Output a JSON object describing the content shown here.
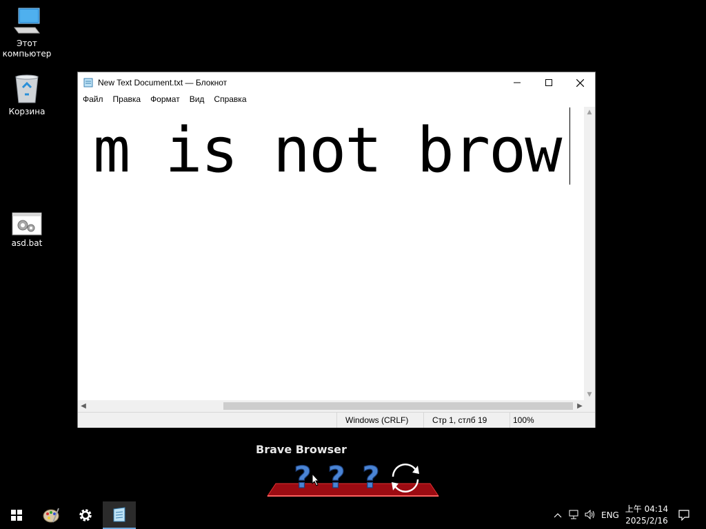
{
  "desktop": {
    "icons": [
      {
        "label_line1": "Этот",
        "label_line2": "компьютер",
        "icon": "computer-icon"
      },
      {
        "label": "Корзина",
        "icon": "recycle-bin-icon"
      },
      {
        "label": "asd.bat",
        "icon": "batch-file-icon"
      }
    ]
  },
  "notepad": {
    "title": "New Text Document.txt — Блокнот",
    "menu": [
      "Файл",
      "Правка",
      "Формат",
      "Вид",
      "Справка"
    ],
    "content": "m is not brow",
    "status": {
      "encoding": "Windows (CRLF)",
      "position": "Стр 1, стлб 19",
      "zoom": "100%"
    }
  },
  "brave_widget": {
    "title": "Brave Browser"
  },
  "taskbar": {
    "clock_time": "上午 04:14",
    "clock_date": "2025/2/16",
    "language": "ENG"
  }
}
